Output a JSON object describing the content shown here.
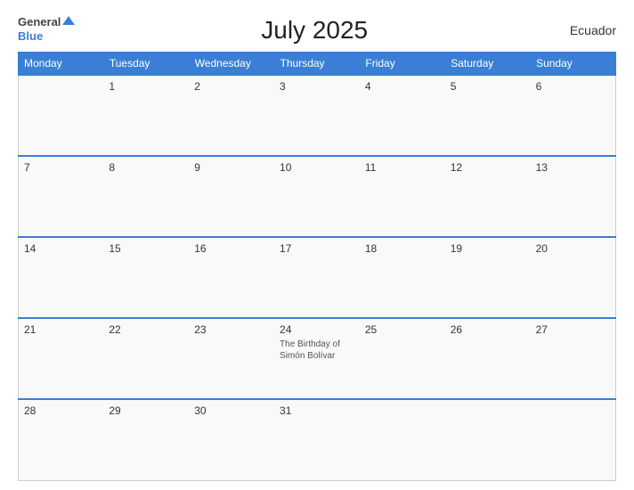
{
  "header": {
    "logo_general": "General",
    "logo_blue": "Blue",
    "title": "July 2025",
    "country": "Ecuador"
  },
  "calendar": {
    "days_of_week": [
      "Monday",
      "Tuesday",
      "Wednesday",
      "Thursday",
      "Friday",
      "Saturday",
      "Sunday"
    ],
    "weeks": [
      [
        {
          "day": "",
          "holiday": ""
        },
        {
          "day": "1",
          "holiday": ""
        },
        {
          "day": "2",
          "holiday": ""
        },
        {
          "day": "3",
          "holiday": ""
        },
        {
          "day": "4",
          "holiday": ""
        },
        {
          "day": "5",
          "holiday": ""
        },
        {
          "day": "6",
          "holiday": ""
        }
      ],
      [
        {
          "day": "7",
          "holiday": ""
        },
        {
          "day": "8",
          "holiday": ""
        },
        {
          "day": "9",
          "holiday": ""
        },
        {
          "day": "10",
          "holiday": ""
        },
        {
          "day": "11",
          "holiday": ""
        },
        {
          "day": "12",
          "holiday": ""
        },
        {
          "day": "13",
          "holiday": ""
        }
      ],
      [
        {
          "day": "14",
          "holiday": ""
        },
        {
          "day": "15",
          "holiday": ""
        },
        {
          "day": "16",
          "holiday": ""
        },
        {
          "day": "17",
          "holiday": ""
        },
        {
          "day": "18",
          "holiday": ""
        },
        {
          "day": "19",
          "holiday": ""
        },
        {
          "day": "20",
          "holiday": ""
        }
      ],
      [
        {
          "day": "21",
          "holiday": ""
        },
        {
          "day": "22",
          "holiday": ""
        },
        {
          "day": "23",
          "holiday": ""
        },
        {
          "day": "24",
          "holiday": "The Birthday of Simón Bolívar"
        },
        {
          "day": "25",
          "holiday": ""
        },
        {
          "day": "26",
          "holiday": ""
        },
        {
          "day": "27",
          "holiday": ""
        }
      ],
      [
        {
          "day": "28",
          "holiday": ""
        },
        {
          "day": "29",
          "holiday": ""
        },
        {
          "day": "30",
          "holiday": ""
        },
        {
          "day": "31",
          "holiday": ""
        },
        {
          "day": "",
          "holiday": ""
        },
        {
          "day": "",
          "holiday": ""
        },
        {
          "day": "",
          "holiday": ""
        }
      ]
    ]
  }
}
